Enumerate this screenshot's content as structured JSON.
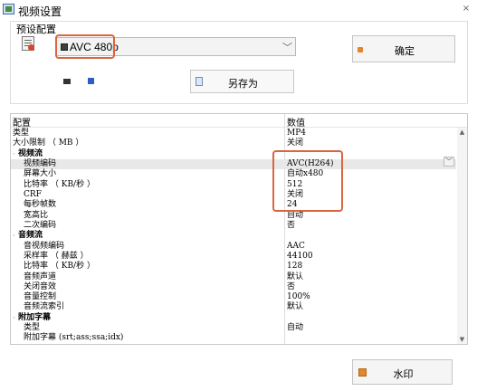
{
  "window": {
    "title": "视频设置",
    "close_glyph": "×"
  },
  "preset": {
    "group_label": "预设配置",
    "selected": "AVC 480p",
    "chevron": "﹀",
    "confirm_label": "确定",
    "save_as_label": "另存为"
  },
  "table": {
    "headers": {
      "name": "配置",
      "value": "数值"
    },
    "rows": [
      {
        "name": "类型",
        "value": "MP4",
        "indent": 0,
        "section": false
      },
      {
        "name": "大小限制 （ MB ）",
        "value": "关闭",
        "indent": 0,
        "section": false
      },
      {
        "name": "视频流",
        "value": "",
        "indent": 1,
        "section": true
      },
      {
        "name": "视频编码",
        "value": "AVC(H264)",
        "indent": 2,
        "section": false,
        "selected": true
      },
      {
        "name": "屏幕大小",
        "value": "自动x480",
        "indent": 2,
        "section": false
      },
      {
        "name": "比特率 （ KB/秒 ）",
        "value": "512",
        "indent": 2,
        "section": false
      },
      {
        "name": "CRF",
        "value": "关闭",
        "indent": 2,
        "section": false
      },
      {
        "name": "每秒帧数",
        "value": "24",
        "indent": 2,
        "section": false
      },
      {
        "name": "宽高比",
        "value": "自动",
        "indent": 2,
        "section": false
      },
      {
        "name": "二次编码",
        "value": "否",
        "indent": 2,
        "section": false
      },
      {
        "name": "音频流",
        "value": "",
        "indent": 1,
        "section": true
      },
      {
        "name": "音视频编码",
        "value": "AAC",
        "indent": 2,
        "section": false
      },
      {
        "name": "采样率 （ 赫兹 ）",
        "value": "44100",
        "indent": 2,
        "section": false
      },
      {
        "name": "比特率 （ KB/秒 ）",
        "value": "128",
        "indent": 2,
        "section": false
      },
      {
        "name": "音频声道",
        "value": "默认",
        "indent": 2,
        "section": false
      },
      {
        "name": "关闭音效",
        "value": "否",
        "indent": 2,
        "section": false
      },
      {
        "name": "音量控制",
        "value": "100%",
        "indent": 2,
        "section": false
      },
      {
        "name": "音频流索引",
        "value": "默认",
        "indent": 2,
        "section": false
      },
      {
        "name": "附加字幕",
        "value": "",
        "indent": 1,
        "section": true
      },
      {
        "name": "类型",
        "value": "自动",
        "indent": 2,
        "section": false
      },
      {
        "name": "附加字幕 (srt;ass;ssa;idx)",
        "value": "",
        "indent": 2,
        "section": false
      }
    ],
    "row_chevron": "﹀",
    "scroll_up": "▲",
    "scroll_down": "▼"
  },
  "footer": {
    "watermark_label": "水印"
  },
  "icons": {
    "app": "video-settings-icon",
    "preset_doc": "preset-document-icon",
    "film": "film-icon",
    "confirm": "confirm-icon",
    "save_as": "save-icon",
    "help": "help-icon",
    "watermark": "watermark-icon"
  },
  "colors": {
    "highlight": "#d9663e",
    "selected_row": "#e8e8e8"
  }
}
